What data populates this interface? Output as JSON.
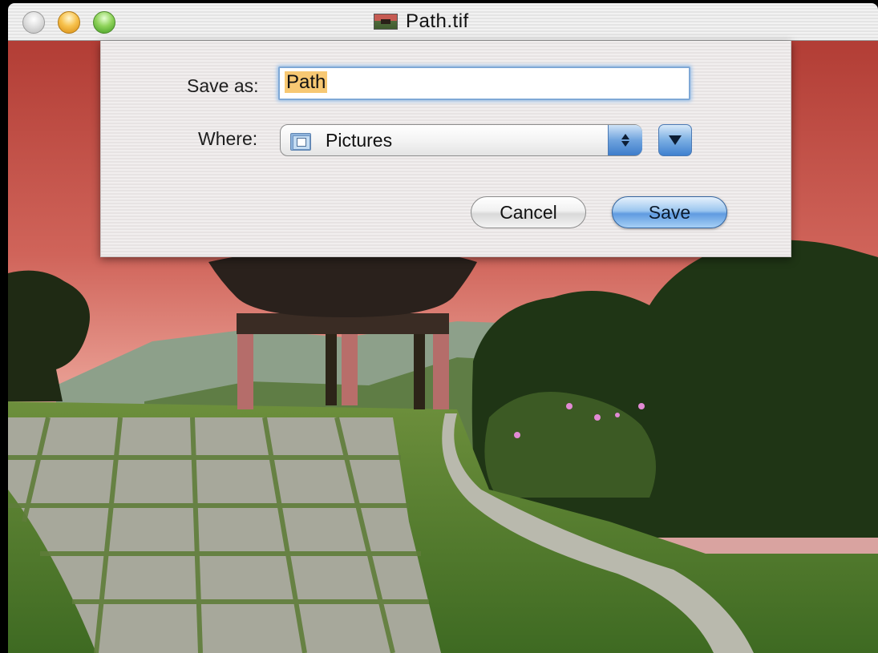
{
  "window": {
    "title": "Path.tif",
    "buttons": {
      "close_icon": "close-traffic-light-icon",
      "minimize_icon": "minimize-traffic-light-icon",
      "zoom_icon": "zoom-traffic-light-icon"
    }
  },
  "save_sheet": {
    "save_as_label": "Save as:",
    "filename_value": "Path",
    "where_label": "Where:",
    "where_value": "Pictures",
    "where_icon": "pictures-folder-icon",
    "cancel_label": "Cancel",
    "save_label": "Save"
  },
  "colors": {
    "default_button": "#5f9be0",
    "selection_highlight": "#f7c873",
    "focus_ring": "#7fa8d6"
  }
}
